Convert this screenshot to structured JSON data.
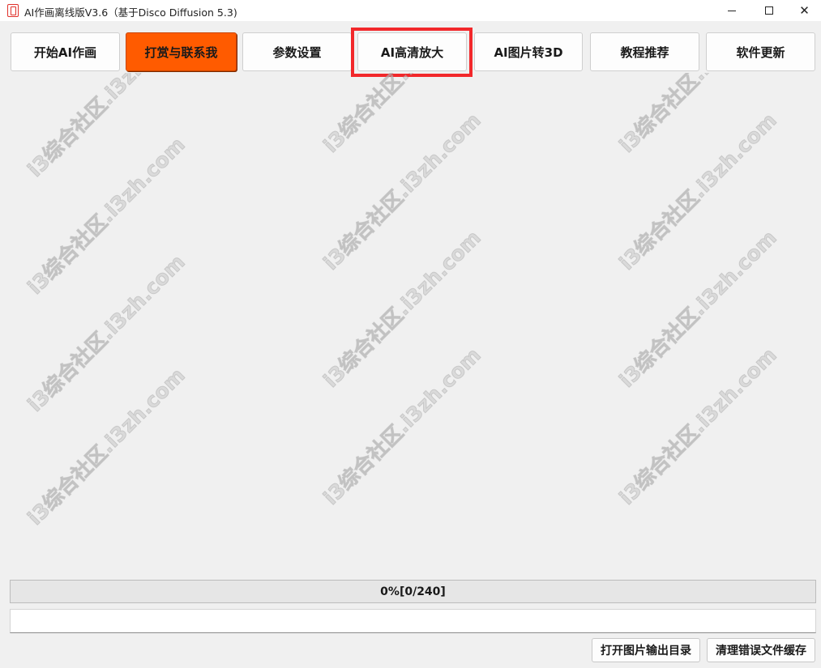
{
  "window": {
    "title": "AI作画离线版V3.6（基于Disco Diffusion 5.3)",
    "controls": {
      "minimize": "–",
      "maximize": "□",
      "close": "✕"
    }
  },
  "toolbar": {
    "buttons": [
      {
        "label": "开始AI作画"
      },
      {
        "label": "打赏与联系我",
        "active": true
      },
      {
        "label": "参数设置"
      },
      {
        "label": "AI高清放大",
        "highlighted": true
      },
      {
        "label": "AI图片转3D"
      },
      {
        "label": "教程推荐"
      },
      {
        "label": "软件更新"
      }
    ]
  },
  "watermark": {
    "text": "i3综合社区.i3zh.com"
  },
  "progress": {
    "text": "0%[0/240]",
    "value": 0,
    "total": 240
  },
  "status": {
    "value": ""
  },
  "bottom": {
    "open_output_label": "打开图片输出目录",
    "clear_cache_label": "清理错误文件缓存"
  },
  "colors": {
    "active_button": "#ff5b00",
    "highlight_border": "#f2282b",
    "background": "#f0f0f0"
  }
}
